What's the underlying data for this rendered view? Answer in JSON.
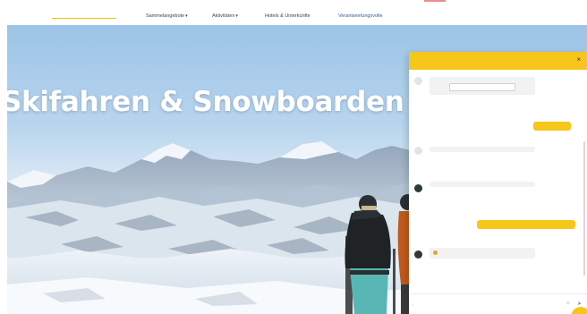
{
  "header": {
    "logo_text": "",
    "nav": [
      {
        "label": "Sammelangebote",
        "has_caret": true
      },
      {
        "label": "Aktivitäten",
        "has_caret": true
      },
      {
        "label": "Hotels & Unterkünfte",
        "has_caret": false
      },
      {
        "label": "Verantwortungsvolle",
        "has_caret": false
      }
    ],
    "caret": "▾"
  },
  "hero": {
    "title": "Skifahren & Snowboarden"
  },
  "chat": {
    "title": "",
    "close_icon": "×",
    "messages": [
      {
        "from": "bot",
        "text": "",
        "button": "",
        "time": ""
      },
      {
        "from": "user",
        "text": "",
        "time": ""
      },
      {
        "from": "bot",
        "text": "",
        "time": ""
      },
      {
        "from": "bot",
        "text": "",
        "time": ""
      },
      {
        "from": "user",
        "text": "",
        "time": ""
      },
      {
        "from": "bot",
        "sender": "",
        "text": "",
        "time": ""
      }
    ],
    "input_placeholder": "",
    "input_prefix": "‹",
    "send_icon": "➤"
  },
  "colors": {
    "accent": "#f7c61a",
    "logo": "#f2b600",
    "hero_sky": "#9cc4e6"
  },
  "icons": [
    "close-icon",
    "send-icon",
    "attach-icon",
    "chat-launcher-icon",
    "chevron-down-icon"
  ]
}
